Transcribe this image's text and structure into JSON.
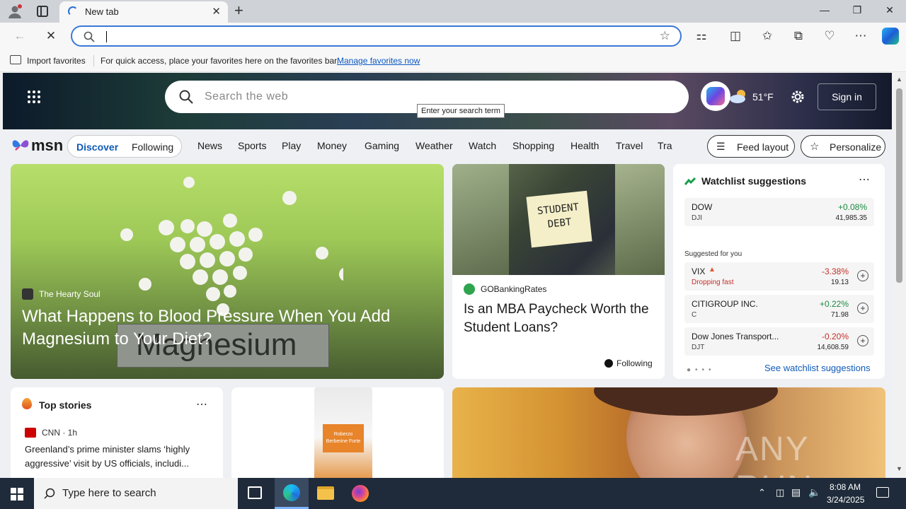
{
  "browser": {
    "tab_title": "New tab",
    "tab_close": "✕",
    "new_tab": "+",
    "address_value": "",
    "fav_import": "Import favorites",
    "fav_message": "For quick access, place your favorites here on the favorites bar.",
    "fav_manage": "Manage favorites now"
  },
  "msn": {
    "search_placeholder": "Search the web",
    "tooltip": "Enter your search term",
    "temperature": "51°F",
    "sign_in": "Sign in",
    "logo": "msn",
    "discover": "Discover",
    "following": "Following",
    "nav": [
      "News",
      "Sports",
      "Play",
      "Money",
      "Gaming",
      "Weather",
      "Watch",
      "Shopping",
      "Health",
      "Travel",
      "Tra"
    ],
    "feed_layout": "Feed layout",
    "personalize": "Personalize",
    "hero_card": {
      "source": "The Hearty Soul",
      "title": "What Happens to Blood Pressure When You Add Magnesium to Your Diet?",
      "image_text": "Magnesium"
    },
    "mba_card": {
      "image_note_line1": "STUDENT",
      "image_note_line2": "DEBT",
      "source": "GOBankingRates",
      "title": "Is an MBA Paycheck Worth the Student Loans?",
      "following": "Following"
    },
    "watchlist": {
      "title": "Watchlist suggestions",
      "dow": {
        "name": "DOW",
        "symbol": "DJI",
        "change": "+0.08%",
        "price": "41,985.35"
      },
      "suggested_label": "Suggested for you",
      "items": [
        {
          "name": "VIX",
          "sub": "Dropping fast",
          "change": "-3.38%",
          "price": "19.13"
        },
        {
          "name": "CITIGROUP INC.",
          "sub": "C",
          "change": "+0.22%",
          "price": "71.98"
        },
        {
          "name": "Dow Jones Transport...",
          "sub": "DJT",
          "change": "-0.20%",
          "price": "14,608.59"
        }
      ],
      "see_link": "See watchlist suggestions"
    },
    "top_stories": {
      "title": "Top stories",
      "source": "CNN · 1h",
      "headline": "Greenland’s prime minister slams ‘highly aggressive’ visit by US officials, includi..."
    },
    "product_card": {
      "label_line1": "Roberzo",
      "label_line2": "Berberine Forte"
    },
    "watermark": "ANY RUN"
  },
  "taskbar": {
    "search_placeholder": "Type here to search",
    "time": "8:08 AM",
    "date": "3/24/2025"
  }
}
